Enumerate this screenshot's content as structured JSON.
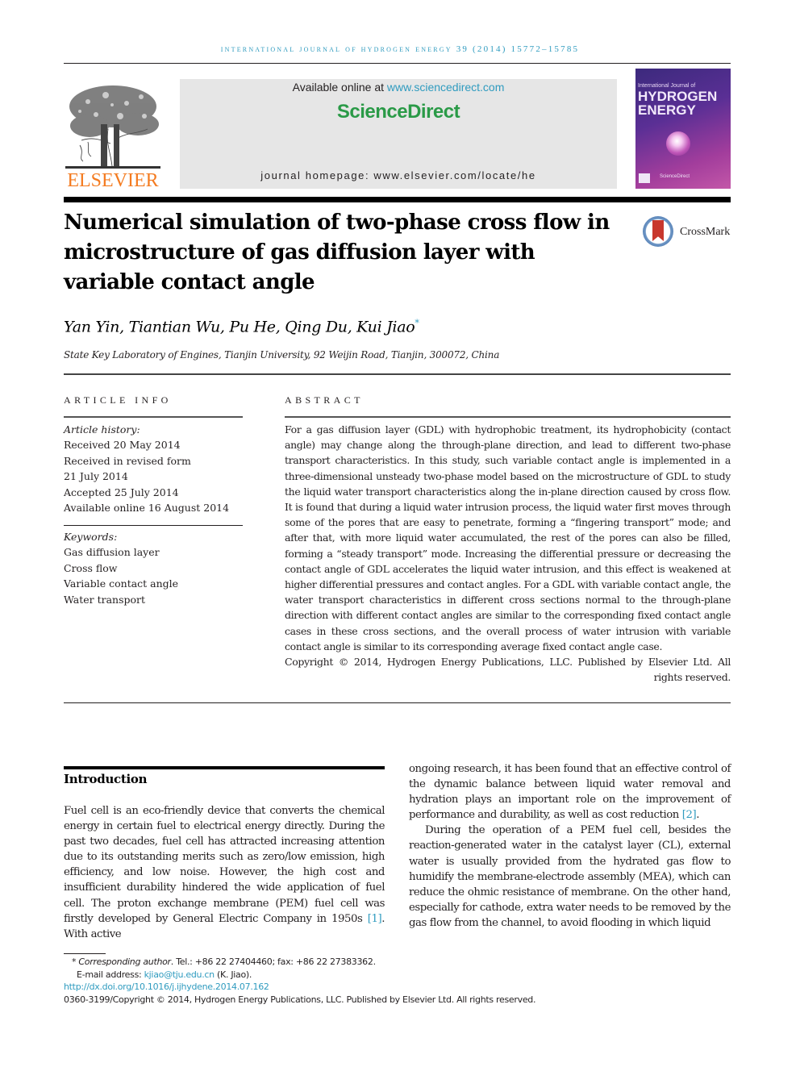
{
  "running_head": "International Journal of Hydrogen Energy 39 (2014) 15772–15785",
  "banner": {
    "publisher": "ELSEVIER",
    "available_prefix": "Available online at ",
    "available_link": "www.sciencedirect.com",
    "platform": "ScienceDirect",
    "homepage": "journal homepage: www.elsevier.com/locate/he",
    "cover": {
      "line1": "International Journal of",
      "line2": "HYDROGEN",
      "line3": "ENERGY",
      "footer": "ScienceDirect"
    }
  },
  "crossmark_label": "CrossMark",
  "title": "Numerical simulation of two-phase cross flow in microstructure of gas diffusion layer with variable contact angle",
  "authors": "Yan Yin, Tiantian Wu, Pu He, Qing Du, Kui Jiao",
  "corresponding_mark": "*",
  "affiliation": "State Key Laboratory of Engines, Tianjin University, 92 Weijin Road, Tianjin, 300072, China",
  "article_info": {
    "heading": "ARTICLE INFO",
    "history_label": "Article history:",
    "history": [
      "Received 20 May 2014",
      "Received in revised form",
      "21 July 2014",
      "Accepted 25 July 2014",
      "Available online 16 August 2014"
    ],
    "keywords_label": "Keywords:",
    "keywords": [
      "Gas diffusion layer",
      "Cross flow",
      "Variable contact angle",
      "Water transport"
    ]
  },
  "abstract": {
    "heading": "ABSTRACT",
    "text": "For a gas diffusion layer (GDL) with hydrophobic treatment, its hydrophobicity (contact angle) may change along the through-plane direction, and lead to different two-phase transport characteristics. In this study, such variable contact angle is implemented in a three-dimensional unsteady two-phase model based on the microstructure of GDL to study the liquid water transport characteristics along the in-plane direction caused by cross flow. It is found that during a liquid water intrusion process, the liquid water first moves through some of the pores that are easy to penetrate, forming a “fingering transport” mode; and after that, with more liquid water accumulated, the rest of the pores can also be filled, forming a “steady transport” mode. Increasing the differential pressure or decreasing the contact angle of GDL accelerates the liquid water intrusion, and this effect is weakened at higher differential pressures and contact angles. For a GDL with variable contact angle, the water transport characteristics in different cross sections normal to the through-plane direction with different contact angles are similar to the corresponding fixed contact angle cases in these cross sections, and the overall process of water intrusion with variable contact angle is similar to its corresponding average fixed contact angle case.",
    "copyright": "Copyright © 2014, Hydrogen Energy Publications, LLC. Published by Elsevier Ltd. All rights reserved."
  },
  "introduction": {
    "heading": "Introduction",
    "left_text_a": "Fuel cell is an eco-friendly device that converts the chemical energy in certain fuel to electrical energy directly. During the past two decades, fuel cell has attracted increasing attention due to its outstanding merits such as zero/low emission, high efficiency, and low noise. However, the high cost and insufficient durability hindered the wide application of fuel cell. The proton exchange membrane (PEM) fuel cell was firstly developed by General Electric Company in 1950s ",
    "ref1": "[1]",
    "left_text_b": ". With active",
    "right_p1_a": "ongoing research, it has been found that an effective control of the dynamic balance between liquid water removal and hydration plays an important role on the improvement of performance and durability, as well as cost reduction ",
    "ref2": "[2]",
    "right_p1_b": ".",
    "right_p2": "During the operation of a PEM fuel cell, besides the reaction-generated water in the catalyst layer (CL), external water is usually provided from the hydrated gas flow to humidify the membrane-electrode assembly (MEA), which can reduce the ohmic resistance of membrane. On the other hand, especially for cathode, extra water needs to be removed by the gas flow from the channel, to avoid flooding in which liquid"
  },
  "footnotes": {
    "star": "*",
    "corresponding_label": "Corresponding author",
    "contact": ". Tel.: +86 22 27404460; fax: +86 22 27383362.",
    "email_label": "E-mail address: ",
    "email": "kjiao@tju.edu.cn",
    "email_suffix": " (K. Jiao).",
    "doi": "http://dx.doi.org/10.1016/j.ijhydene.2014.07.162",
    "issn_copyright": "0360-3199/Copyright © 2014, Hydrogen Energy Publications, LLC. Published by Elsevier Ltd. All rights reserved."
  }
}
